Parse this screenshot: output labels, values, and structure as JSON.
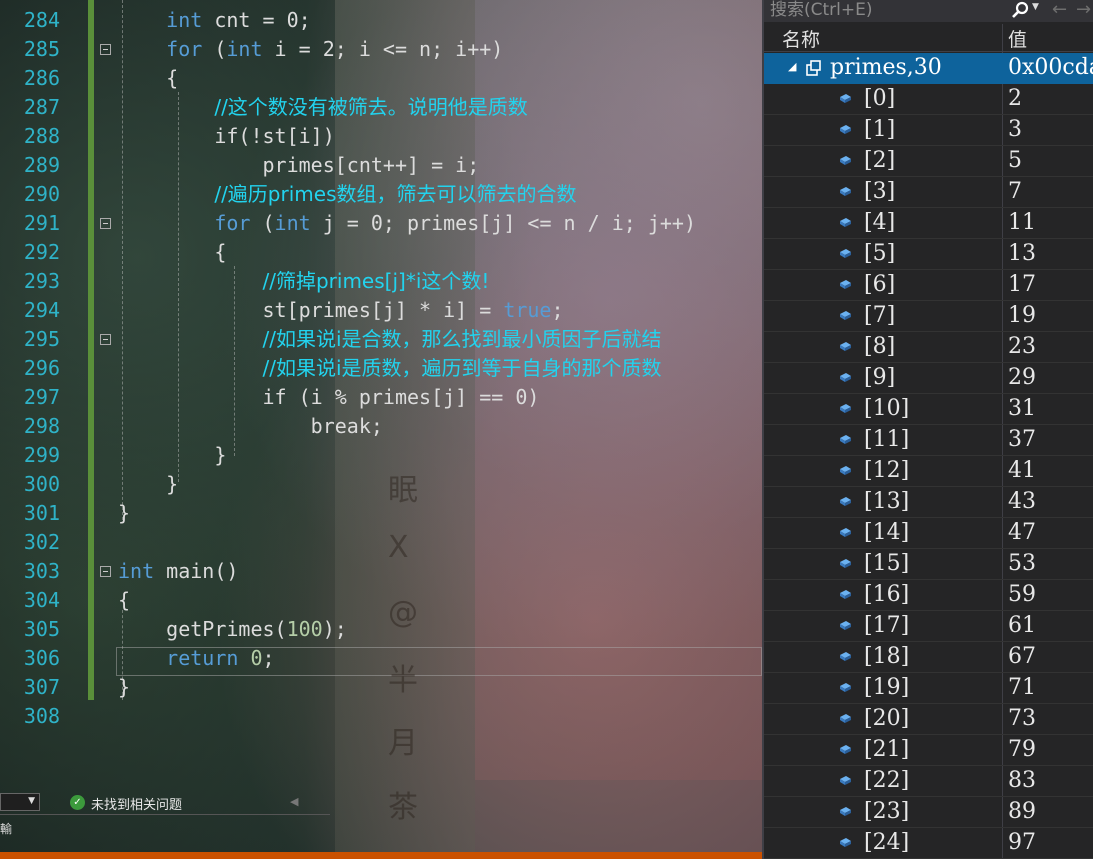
{
  "editor": {
    "line_numbers": [
      "284",
      "285",
      "286",
      "287",
      "288",
      "289",
      "290",
      "291",
      "292",
      "293",
      "294",
      "295",
      "296",
      "297",
      "298",
      "299",
      "300",
      "301",
      "302",
      "303",
      "304",
      "305",
      "306",
      "307",
      "308"
    ],
    "code": {
      "l284": {
        "indent": "    ",
        "kw": "int",
        "rest": " cnt = 0;"
      },
      "l285": {
        "indent": "    ",
        "kw1": "for",
        "p1": " (",
        "kw2": "int",
        "rest": " i = 2; i <= n; i++)"
      },
      "l286": {
        "text": "    {"
      },
      "l287": {
        "indent": "        ",
        "comment": "//这个数没有被筛去。说明他是质数"
      },
      "l288": {
        "text": "        if(!st[i])"
      },
      "l289": {
        "text": "            primes[cnt++] = i;"
      },
      "l290": {
        "indent": "        ",
        "comment": "//遍历primes数组，筛去可以筛去的合数"
      },
      "l291": {
        "indent": "        ",
        "kw1": "for",
        "p1": " (",
        "kw2": "int",
        "rest": " j = 0; primes[j] <= n / i; j++)"
      },
      "l292": {
        "text": "        {"
      },
      "l293": {
        "indent": "            ",
        "comment": "//筛掉primes[j]*i这个数!"
      },
      "l294": {
        "pre": "            st[primes[j] * i] = ",
        "kw": "true",
        "post": ";"
      },
      "l295": {
        "indent": "            ",
        "comment": "//如果说i是合数，那么找到最小质因子后就结"
      },
      "l296": {
        "indent": "            ",
        "comment": "//如果说i是质数，遍历到等于自身的那个质数"
      },
      "l297": {
        "text": "            if (i % primes[j] == 0)"
      },
      "l298": {
        "text": "                break;"
      },
      "l299": {
        "text": "        }"
      },
      "l300": {
        "text": "    }"
      },
      "l301": {
        "text": "}"
      },
      "l302": {
        "text": ""
      },
      "l303": {
        "kw": "int",
        "rest": " main()"
      },
      "l304": {
        "text": "{"
      },
      "l305": {
        "pre": "    getPrimes(",
        "num": "100",
        "post": ");"
      },
      "l306": {
        "indent": "    ",
        "kw": "return",
        "sp": " ",
        "num": "0",
        "post": ";"
      },
      "l307": {
        "text": "}"
      },
      "l308": {
        "text": ""
      }
    },
    "watermark_chars": [
      "眠",
      "X",
      "@",
      "半",
      "月",
      "茶"
    ]
  },
  "status": {
    "issues_text": "未找到相关问题",
    "tiny_label": "輸"
  },
  "watch": {
    "search_placeholder": "搜索(Ctrl+E)",
    "col_name": "名称",
    "col_value": "值",
    "root": {
      "name": "primes,30",
      "value": "0x00cda"
    },
    "items": [
      {
        "name": "[0]",
        "value": "2"
      },
      {
        "name": "[1]",
        "value": "3"
      },
      {
        "name": "[2]",
        "value": "5"
      },
      {
        "name": "[3]",
        "value": "7"
      },
      {
        "name": "[4]",
        "value": "11"
      },
      {
        "name": "[5]",
        "value": "13"
      },
      {
        "name": "[6]",
        "value": "17"
      },
      {
        "name": "[7]",
        "value": "19"
      },
      {
        "name": "[8]",
        "value": "23"
      },
      {
        "name": "[9]",
        "value": "29"
      },
      {
        "name": "[10]",
        "value": "31"
      },
      {
        "name": "[11]",
        "value": "37"
      },
      {
        "name": "[12]",
        "value": "41"
      },
      {
        "name": "[13]",
        "value": "43"
      },
      {
        "name": "[14]",
        "value": "47"
      },
      {
        "name": "[15]",
        "value": "53"
      },
      {
        "name": "[16]",
        "value": "59"
      },
      {
        "name": "[17]",
        "value": "61"
      },
      {
        "name": "[18]",
        "value": "67"
      },
      {
        "name": "[19]",
        "value": "71"
      },
      {
        "name": "[20]",
        "value": "73"
      },
      {
        "name": "[21]",
        "value": "79"
      },
      {
        "name": "[22]",
        "value": "83"
      },
      {
        "name": "[23]",
        "value": "89"
      },
      {
        "name": "[24]",
        "value": "97"
      }
    ]
  },
  "colors": {
    "line_number": "#2fb3c8",
    "keyword": "#569cd6",
    "comment": "#22d3ee",
    "selection": "#0e639c",
    "status_bar": "#ca5100",
    "change_bar": "#5a8f3a"
  }
}
